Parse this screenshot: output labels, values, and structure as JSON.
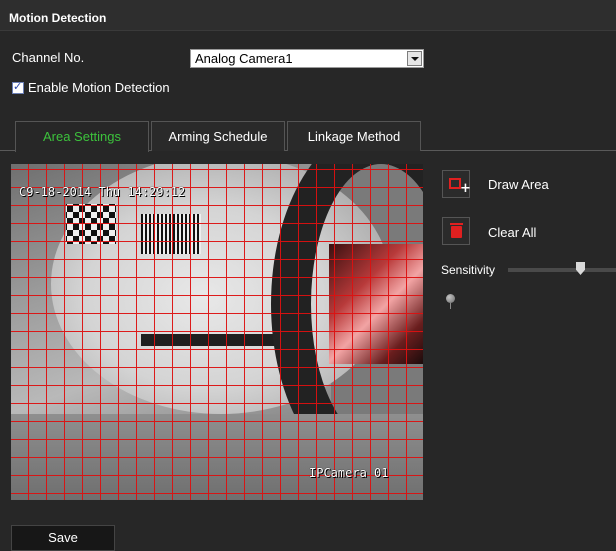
{
  "header": {
    "title": "Motion Detection"
  },
  "channel": {
    "label": "Channel No.",
    "selected": "Analog Camera1"
  },
  "enable_motion": {
    "label": "Enable Motion Detection",
    "checked": true
  },
  "tabs": [
    {
      "label": "Area Settings",
      "active": true
    },
    {
      "label": "Arming Schedule",
      "active": false
    },
    {
      "label": "Linkage Method",
      "active": false
    }
  ],
  "video": {
    "timestamp_osd": "C9-18-2014 Thu 14:29:12",
    "camera_osd": "IPCamera 01",
    "grid_color": "#dd1111"
  },
  "actions": {
    "draw_area": "Draw Area",
    "clear_all": "Clear All"
  },
  "sensitivity": {
    "label": "Sensitivity",
    "level_percent": 64
  },
  "footer": {
    "save_label": "Save"
  },
  "colors": {
    "active_tab": "#3cc23c",
    "accent_red": "#e02020",
    "background": "#272727"
  }
}
